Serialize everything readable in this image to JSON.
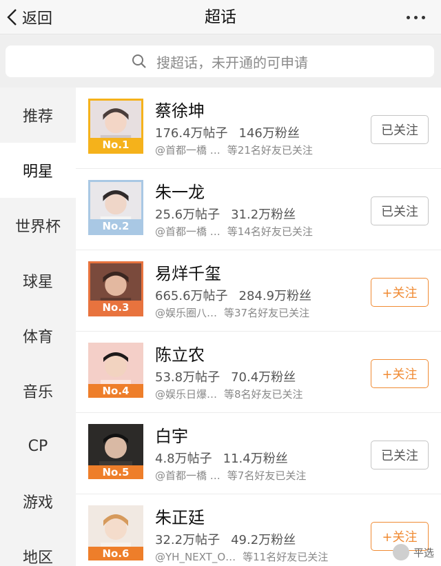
{
  "header": {
    "back_label": "返回",
    "title": "超话"
  },
  "search": {
    "placeholder": "搜超话，未开通的可申请"
  },
  "sidebar": {
    "items": [
      {
        "label": "推荐",
        "active": false
      },
      {
        "label": "明星",
        "active": true
      },
      {
        "label": "世界杯",
        "active": false
      },
      {
        "label": "球星",
        "active": false
      },
      {
        "label": "体育",
        "active": false
      },
      {
        "label": "音乐",
        "active": false
      },
      {
        "label": "CP",
        "active": false
      },
      {
        "label": "游戏",
        "active": false
      },
      {
        "label": "地区",
        "active": false
      }
    ]
  },
  "list": [
    {
      "name": "蔡徐坤",
      "posts": "176.4万帖子",
      "fans": "146万粉丝",
      "host": "@首都一橋 …",
      "friends": "等21名好友已关注",
      "rank": "No.1",
      "button": "已关注",
      "followed": true
    },
    {
      "name": "朱一龙",
      "posts": "25.6万帖子",
      "fans": "31.2万粉丝",
      "host": "@首都一橋 …",
      "friends": "等14名好友已关注",
      "rank": "No.2",
      "button": "已关注",
      "followed": true
    },
    {
      "name": "易烊千玺",
      "posts": "665.6万帖子",
      "fans": "284.9万粉丝",
      "host": "@娱乐圈八…",
      "friends": "等37名好友已关注",
      "rank": "No.3",
      "button": "+关注",
      "followed": false
    },
    {
      "name": "陈立农",
      "posts": "53.8万帖子",
      "fans": "70.4万粉丝",
      "host": "@娱乐日爆…",
      "friends": "等8名好友已关注",
      "rank": "No.4",
      "button": "+关注",
      "followed": false
    },
    {
      "name": "白宇",
      "posts": "4.8万帖子",
      "fans": "11.4万粉丝",
      "host": "@首都一橋 …",
      "friends": "等7名好友已关注",
      "rank": "No.5",
      "button": "已关注",
      "followed": true
    },
    {
      "name": "朱正廷",
      "posts": "32.2万帖子",
      "fans": "49.2万粉丝",
      "host": "@YH_NEXT_O…",
      "friends": "等11名好友已关注",
      "rank": "No.6",
      "button": "+关注",
      "followed": false
    }
  ],
  "watermark": {
    "text": "平选"
  },
  "colors": {
    "gold": "#f5b21b",
    "silver": "#a9c8e4",
    "bronze": "#e8733e",
    "orange": "#ee7e2a",
    "follow": "#f08a32"
  }
}
